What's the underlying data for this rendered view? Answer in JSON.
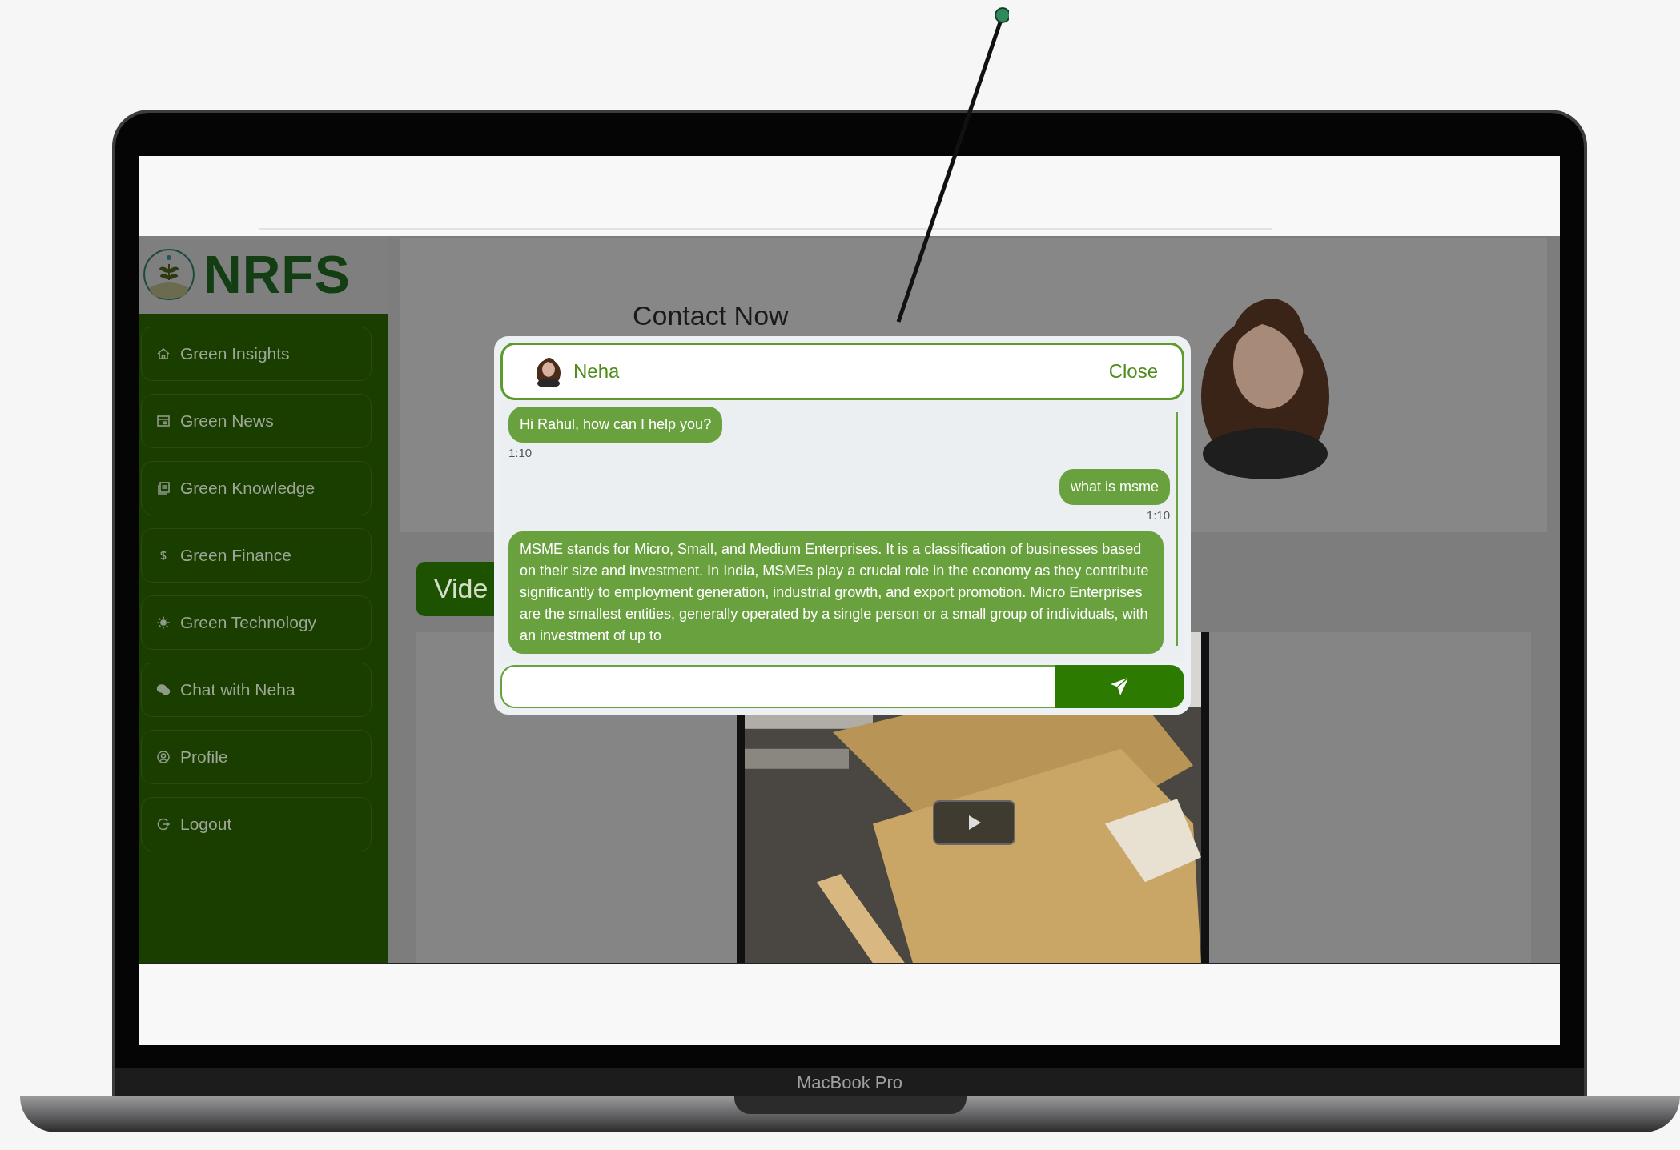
{
  "brand": {
    "name": "NRFS"
  },
  "sidebar": {
    "items": [
      {
        "label": "Green Insights"
      },
      {
        "label": "Green News"
      },
      {
        "label": "Green Knowledge"
      },
      {
        "label": "Green Finance"
      },
      {
        "label": "Green Technology"
      },
      {
        "label": "Chat with Neha"
      },
      {
        "label": "Profile"
      },
      {
        "label": "Logout"
      }
    ]
  },
  "page": {
    "heading": "Contact Now",
    "video_tab": "Vide"
  },
  "chat": {
    "agent": "Neha",
    "close": "Close",
    "messages": [
      {
        "kind": "received",
        "text": "Hi Rahul, how can I help you?",
        "time": "1:10"
      },
      {
        "kind": "sent",
        "text": "what is msme",
        "time": "1:10"
      },
      {
        "kind": "received",
        "text": "MSME stands for Micro, Small, and Medium Enterprises. It is a classification of businesses based on their size and investment. In India, MSMEs play a crucial role in the economy as they contribute significantly to employment generation, industrial growth, and export promotion. Micro Enterprises are the smallest entities, generally operated by a single person or a small group of individuals, with an investment of up to"
      }
    ]
  },
  "device": {
    "label": "MacBook Pro"
  }
}
